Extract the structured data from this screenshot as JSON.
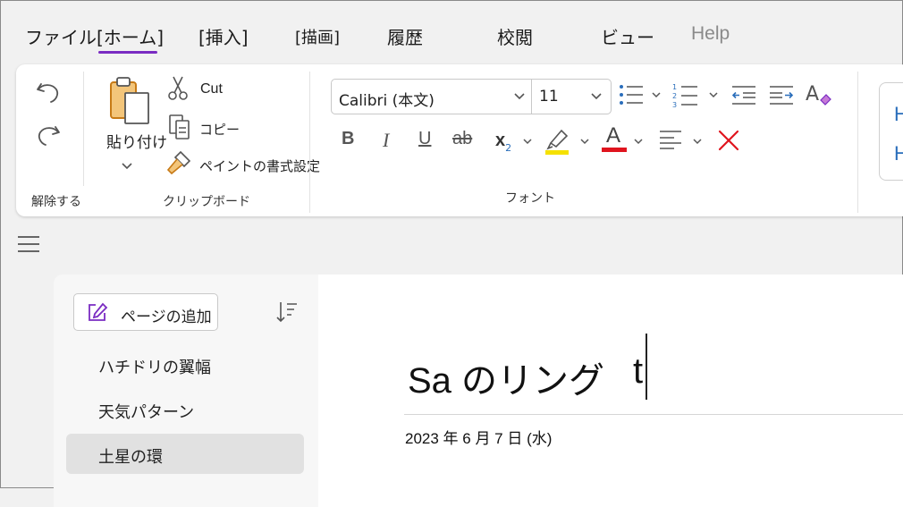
{
  "menu": {
    "file": "ファイル",
    "home": "[ホーム]",
    "insert": "[挿入]",
    "draw": "[描画]",
    "history": "履歴",
    "review": "校閲",
    "view": "ビュー",
    "help": "Help"
  },
  "ribbon": {
    "undo_group_label": "解除する",
    "clipboard": {
      "label": "クリップボード",
      "paste": "貼り付け",
      "cut": "Cut",
      "copy": "コピー",
      "format_painter": "ペイントの書式設定"
    },
    "font": {
      "label": "フォント",
      "family": "Calibri (本文)",
      "size": "11",
      "bold": "B",
      "italic": "I",
      "underline": "U",
      "strikethrough": "ab",
      "subscript": "x",
      "subscript_small": "2",
      "font_color_letter": "A",
      "highlight_color": "#f5e100",
      "font_color": "#e0141e",
      "clear_color": "#e0141e"
    },
    "styles_partial": [
      "H",
      "H"
    ]
  },
  "sidebar": {
    "add_page": "ページの追加",
    "pages": [
      {
        "title": "ハチドリの翼幅"
      },
      {
        "title": "天気パターン"
      },
      {
        "title": "土星の環",
        "selected": true
      }
    ]
  },
  "page": {
    "title": "Sa のリング",
    "typing": "t",
    "date": "2023 年 6 月 7 日 (水)"
  },
  "colors": {
    "accent": "#7a2cc2",
    "link_blue": "#2a6ebb"
  }
}
